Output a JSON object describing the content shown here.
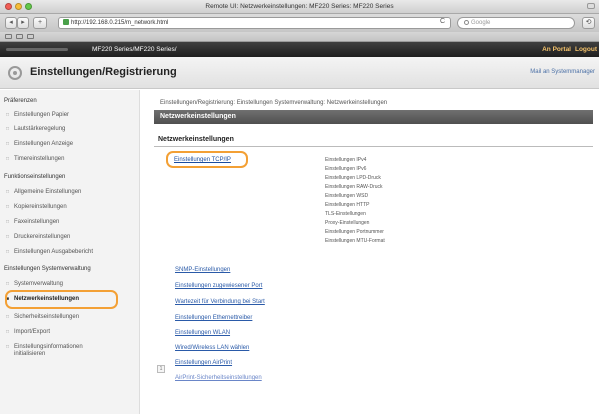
{
  "window": {
    "title": "Remote UI: Netzwerkeinstellungen: MF220 Series: MF220 Series"
  },
  "browser": {
    "back": "◂",
    "forward": "▸",
    "add": "+",
    "url": "http://192.168.0.215/m_network.html",
    "reload": "C",
    "search_placeholder": "Google",
    "reader": "⟲"
  },
  "app": {
    "device": "MF220 Series/MF220 Series/",
    "portal": "An Portal",
    "logout": "Logout",
    "title": "Einstellungen/Registrierung",
    "mail": "Mail an Systemmanager"
  },
  "sidebar": {
    "sections": [
      {
        "label": "Präferenzen",
        "items": [
          "Einstellungen Papier",
          "Lautstärkeregelung",
          "Einstellungen Anzeige",
          "Timereinstellungen"
        ]
      },
      {
        "label": "Funktionseinstellungen",
        "items": [
          "Allgemeine Einstellungen",
          "Kopiereinstellungen",
          "Faxeinstellungen",
          "Druckereinstellungen",
          "Einstellungen Ausgabebericht"
        ]
      },
      {
        "label": "Einstellungen Systemverwaltung",
        "items": [
          "Systemverwaltung",
          "Netzwerkeinstellungen",
          "Sicherheitseinstellungen",
          "Import/Export",
          "Einstellungsinformationen initialisieren"
        ]
      }
    ]
  },
  "main": {
    "breadcrumb": "Einstellungen/Registrierung: Einstellungen Systemverwaltung: Netzwerkeinstellungen",
    "panel_title": "Netzwerkeinstellungen",
    "section_title": "Netzwerkeinstellungen",
    "tcp_link": "Einstellungen TCP/IP",
    "tcp_subitems": [
      "Einstellungen IPv4",
      "Einstellungen IPv6",
      "Einstellungen LPD-Druck",
      "Einstellungen RAW-Druck",
      "Einstellungen WSD",
      "Einstellungen HTTP",
      "TLS-Einstellungen",
      "Proxy-Einstellungen",
      "Einstellungen Portnummer",
      "Einstellungen MTU-Format"
    ],
    "links": [
      "SNMP-Einstellungen",
      "Einstellungen zugewiesener Port",
      "Wartezeit für Verbindung bei Start",
      "Einstellungen Ethernettreiber",
      "Einstellungen WLAN",
      "Wired/Wireless LAN wählen",
      "Einstellungen AirPrint",
      "AirPrint-Sicherheitseinstellungen"
    ],
    "page_button": "1"
  }
}
